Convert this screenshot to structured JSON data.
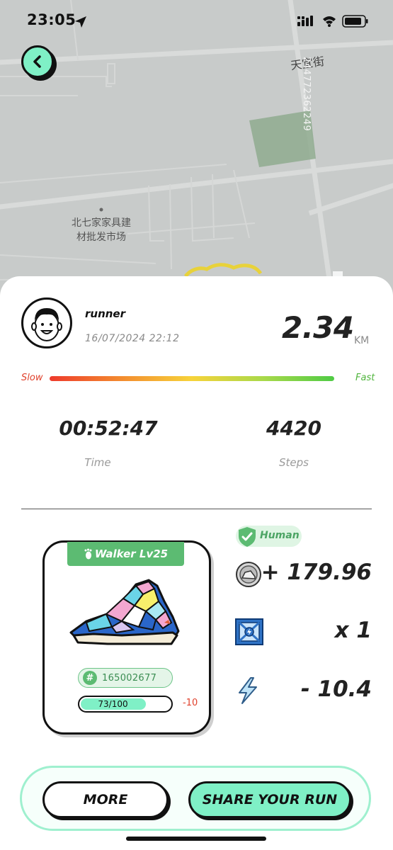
{
  "status_bar": {
    "time": "23:05"
  },
  "map": {
    "street_label": "天宜街",
    "poi_label_line1": "北七家家具建",
    "poi_label_line2": "材批发市场",
    "watermark": "244772362249"
  },
  "run": {
    "user_name": "runner",
    "datetime": "16/07/2024 22:12",
    "distance": "2.34",
    "distance_unit": "KM",
    "speed_slow_label": "Slow",
    "speed_fast_label": "Fast",
    "time_value": "00:52:47",
    "time_label": "Time",
    "steps_value": "4420",
    "steps_label": "Steps"
  },
  "sneaker": {
    "title": "Walker Lv25",
    "id": "165002677",
    "durability_text": "73/100",
    "durability_fraction": 0.73,
    "durability_delta": "-10"
  },
  "rewards": {
    "human_label": "Human",
    "token_value": "+ 179.96",
    "mystery_box_value": "x 1",
    "energy_value": "- 10.4"
  },
  "actions": {
    "more_label": "MORE",
    "share_label": "SHARE YOUR RUN"
  },
  "colors": {
    "accent_mint": "#7ff0c6",
    "level_green": "#5cbb72",
    "slow_red": "#e0412c",
    "fast_green": "#51b53e"
  }
}
